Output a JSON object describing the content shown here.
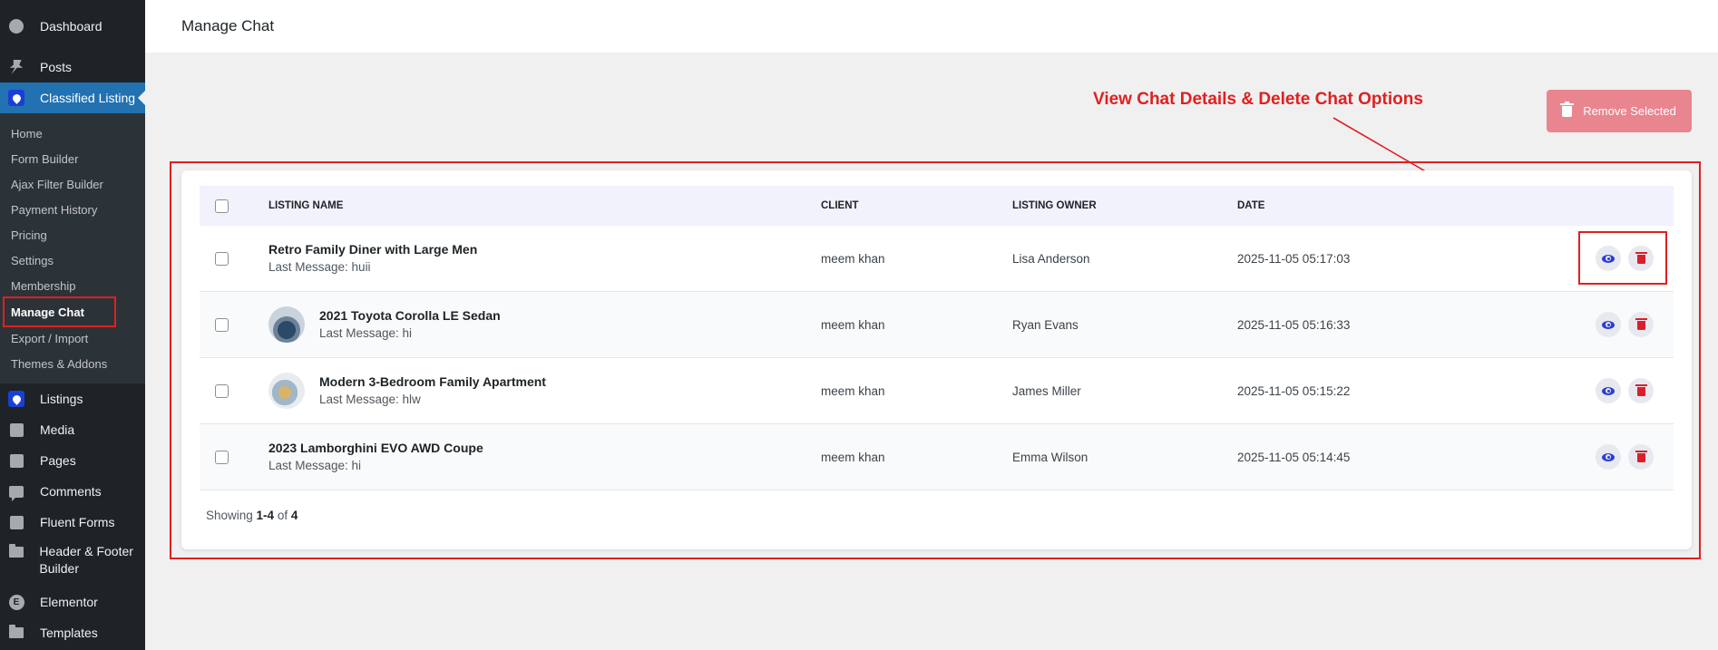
{
  "sidebar": {
    "items_top": [
      {
        "label": "Dashboard",
        "icon": "dashboard-icon"
      },
      {
        "label": "Posts",
        "icon": "pin-icon"
      }
    ],
    "current": {
      "label": "Classified Listing",
      "icon": "location-pin-icon"
    },
    "submenu": [
      "Home",
      "Form Builder",
      "Ajax Filter Builder",
      "Payment History",
      "Pricing",
      "Settings",
      "Membership",
      "Manage Chat",
      "Export / Import",
      "Themes & Addons"
    ],
    "items_bottom": [
      {
        "label": "Listings",
        "icon": "location-pin-icon"
      },
      {
        "label": "Media",
        "icon": "media-icon"
      },
      {
        "label": "Pages",
        "icon": "pages-icon"
      },
      {
        "label": "Comments",
        "icon": "comment-icon"
      },
      {
        "label": "Fluent Forms",
        "icon": "forms-icon"
      },
      {
        "label": "Header & Footer Builder",
        "icon": "folder-icon"
      },
      {
        "label": "Elementor",
        "icon": "elementor-icon"
      },
      {
        "label": "Templates",
        "icon": "folder-icon"
      }
    ]
  },
  "header": {
    "title": "Manage Chat"
  },
  "annotation": {
    "text": "View Chat Details & Delete Chat Options",
    "color": "#e02020"
  },
  "toolbar": {
    "remove_selected_label": "Remove Selected"
  },
  "table": {
    "columns": [
      "LISTING NAME",
      "CLIENT",
      "LISTING OWNER",
      "DATE"
    ],
    "rows": [
      {
        "name": "Retro Family Diner with Large Men",
        "last_message": "Last Message: huii",
        "client": "meem khan",
        "owner": "Lisa Anderson",
        "date": "2025-11-05 05:17:03",
        "thumbnail": false
      },
      {
        "name": "2021 Toyota Corolla LE Sedan",
        "last_message": "Last Message: hi",
        "client": "meem khan",
        "owner": "Ryan Evans",
        "date": "2025-11-05 05:16:33",
        "thumbnail": "car"
      },
      {
        "name": "Modern 3-Bedroom Family Apartment",
        "last_message": "Last Message: hlw",
        "client": "meem khan",
        "owner": "James Miller",
        "date": "2025-11-05 05:15:22",
        "thumbnail": "apartment"
      },
      {
        "name": "2023 Lamborghini EVO AWD Coupe",
        "last_message": "Last Message: hi",
        "client": "meem khan",
        "owner": "Emma Wilson",
        "date": "2025-11-05 05:14:45",
        "thumbnail": false
      }
    ]
  },
  "pagination": {
    "prefix": "Showing ",
    "range": "1-4",
    "of": " of ",
    "total": "4"
  },
  "colors": {
    "accent": "#2271b1",
    "sidebar_bg": "#1d2327",
    "danger": "#d8202b",
    "view": "#2b3fd6",
    "remove_button": "#e9858f"
  }
}
